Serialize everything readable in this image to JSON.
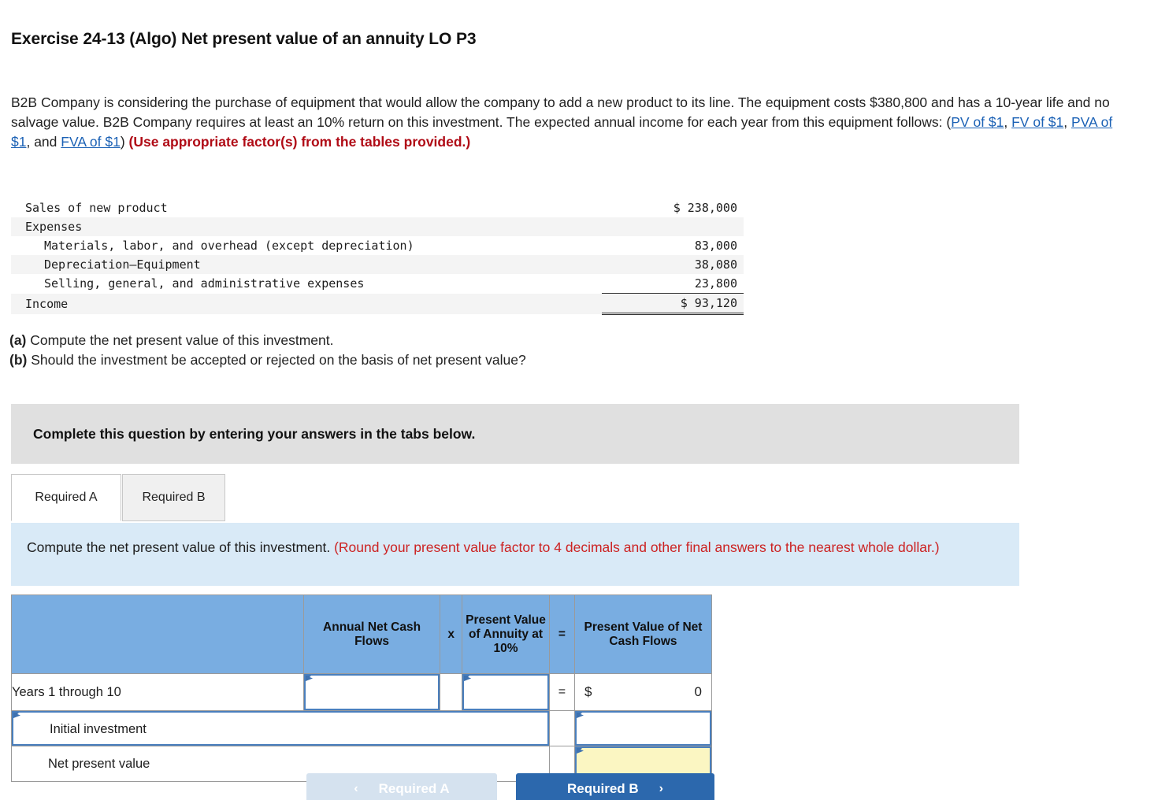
{
  "title": "Exercise 24-13 (Algo) Net present value of an annuity LO P3",
  "intro": {
    "part1": "B2B Company is considering the purchase of equipment that would allow the company to add a new product to its line. The equipment costs $380,800 and has a 10-year life and no salvage value. B2B Company requires at least an 10% return on this investment. The expected annual income for each year from this equipment follows: (",
    "links": [
      "PV of $1",
      "FV of $1",
      "PVA of $1",
      "FVA of $1"
    ],
    "sep1": ", ",
    "sep2": ", ",
    "sep3": ", and ",
    "close": ") ",
    "bold_red": "(Use appropriate factor(s) from the tables provided.)"
  },
  "fin_table": {
    "rows": [
      {
        "label": "Sales of new product",
        "amount": "$ 238,000",
        "shade": false,
        "indent": 0,
        "rule": "none"
      },
      {
        "label": "Expenses",
        "amount": "",
        "shade": true,
        "indent": 0,
        "rule": "none"
      },
      {
        "label": "Materials, labor, and overhead (except depreciation)",
        "amount": "83,000",
        "shade": false,
        "indent": 1,
        "rule": "none"
      },
      {
        "label": "Depreciation—Equipment",
        "amount": "38,080",
        "shade": true,
        "indent": 1,
        "rule": "none"
      },
      {
        "label": "Selling, general, and administrative expenses",
        "amount": "23,800",
        "shade": false,
        "indent": 1,
        "rule": "none"
      },
      {
        "label": "Income",
        "amount": "$ 93,120",
        "shade": true,
        "indent": 0,
        "rule": "double"
      }
    ]
  },
  "questions": {
    "a_marker": "(a)",
    "a_text": " Compute the net present value of this investment.",
    "b_marker": "(b)",
    "b_text": " Should the investment be accepted or rejected on the basis of net present value?"
  },
  "gray_bar": {
    "text": "Complete this question by entering your answers in the tabs below."
  },
  "tabs": [
    {
      "label": "Required A",
      "active": true
    },
    {
      "label": "Required B",
      "active": false
    }
  ],
  "blue_box": {
    "black_text": "Compute the net present value of this investment. ",
    "red_text": "(Round your present value factor to 4 decimals and other final answers to the nearest whole dollar.)"
  },
  "answer_table": {
    "headers": {
      "blank": "",
      "annual_net_cash_flows": "Annual Net Cash Flows",
      "times": "x",
      "pv_annuity": "Present Value of Annuity at 10%",
      "equals": "=",
      "pv_net_cash_flows": "Present Value of Net Cash Flows"
    },
    "rows": [
      {
        "label": "Years 1 through 10",
        "equals": "=",
        "currency": "$",
        "value": "0"
      },
      {
        "label": "Initial investment"
      },
      {
        "label": "Net present value"
      }
    ]
  },
  "nav": {
    "prev_label": "Required A",
    "prev_chevron": "‹",
    "next_label": "Required B",
    "next_chevron": "›"
  },
  "colors": {
    "header_blue": "#79ade1",
    "instruction_blue": "#d9eaf7",
    "gray_bar": "#e0e0e0",
    "link_blue": "#1b61b5",
    "red": "#cc2222",
    "dark_red": "#b00b16",
    "input_border": "#4a7fbd",
    "highlight_yellow": "#fbf6c2",
    "next_button": "#2c68ad"
  }
}
